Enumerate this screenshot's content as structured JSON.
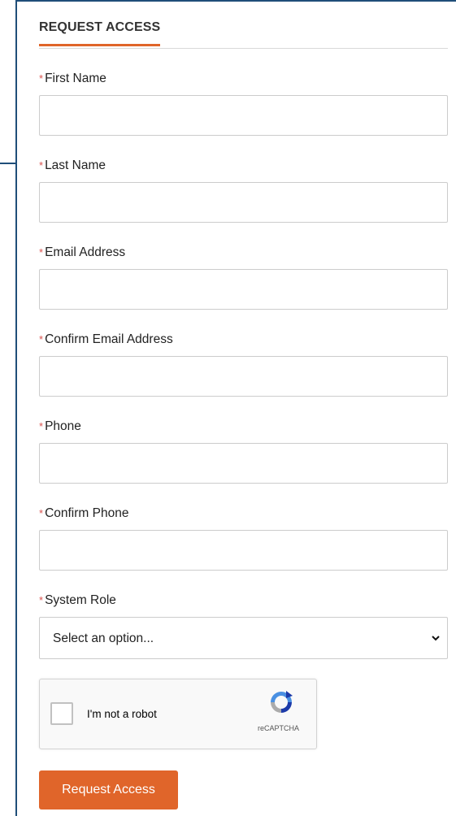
{
  "form": {
    "title": "REQUEST ACCESS",
    "required_marker": "*",
    "fields": [
      {
        "label": "First Name",
        "value": ""
      },
      {
        "label": "Last Name",
        "value": ""
      },
      {
        "label": "Email Address",
        "value": ""
      },
      {
        "label": "Confirm Email Address",
        "value": ""
      },
      {
        "label": "Phone",
        "value": ""
      },
      {
        "label": "Confirm Phone",
        "value": ""
      }
    ],
    "system_role": {
      "label": "System Role",
      "selected": "Select an option..."
    },
    "captcha": {
      "checkbox_label": "I'm not a robot",
      "brand": "reCAPTCHA"
    },
    "submit_label": "Request Access"
  },
  "colors": {
    "accent": "#e0652a",
    "required": "#d9534f",
    "frame_line": "#1f4e79"
  },
  "icons": {
    "select": "chevron-down-icon",
    "captcha": "recaptcha-logo-icon"
  }
}
